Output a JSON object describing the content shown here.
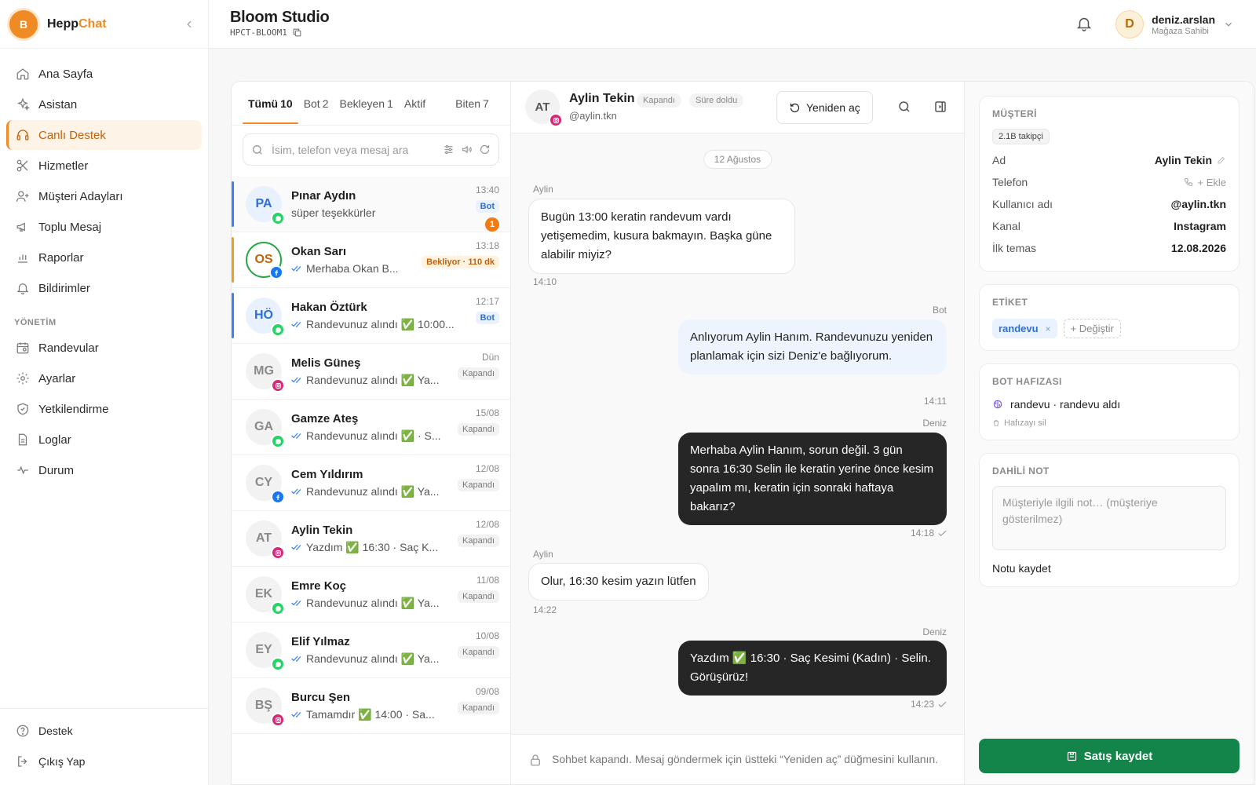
{
  "brand": {
    "initial": "B",
    "name_part1": "Hepp",
    "name_part2": "Chat"
  },
  "nav": {
    "items": [
      {
        "label": "Ana Sayfa"
      },
      {
        "label": "Asistan"
      },
      {
        "label": "Canlı Destek",
        "active": true
      },
      {
        "label": "Hizmetler"
      },
      {
        "label": "Müşteri Adayları"
      },
      {
        "label": "Toplu Mesaj"
      },
      {
        "label": "Raporlar"
      },
      {
        "label": "Bildirimler"
      }
    ],
    "section_label": "YÖNETİM",
    "admin_items": [
      {
        "label": "Randevular"
      },
      {
        "label": "Ayarlar"
      },
      {
        "label": "Yetkilendirme"
      },
      {
        "label": "Loglar"
      },
      {
        "label": "Durum"
      }
    ],
    "bottom_items": [
      {
        "label": "Destek"
      },
      {
        "label": "Çıkış Yap"
      }
    ]
  },
  "header": {
    "workspace_title": "Bloom Studio",
    "workspace_code": "HPCT-BLOOM1",
    "user_initial": "D",
    "user_name": "deniz.arslan",
    "user_role": "Mağaza Sahibi"
  },
  "tabs": [
    {
      "label": "Tümü",
      "count": "10",
      "active": true
    },
    {
      "label": "Bot",
      "count": "2"
    },
    {
      "label": "Bekleyen",
      "count": "1"
    },
    {
      "label": "Aktif",
      "count": ""
    },
    {
      "label": "Biten",
      "count": "7"
    }
  ],
  "search": {
    "placeholder": "İsim, telefon veya mesaj ara"
  },
  "conversations": [
    {
      "initials": "PA",
      "name": "Pınar Aydın",
      "preview": "süper teşekkürler",
      "time": "13:40",
      "tag": "Bot",
      "unread": "1",
      "channel": "whatsapp"
    },
    {
      "initials": "OS",
      "name": "Okan Sarı",
      "preview": "Merhaba Okan B...",
      "time": "13:18",
      "tag": "Bekliyor · 110 dk",
      "channel": "facebook"
    },
    {
      "initials": "HÖ",
      "name": "Hakan Öztürk",
      "preview": "Randevunuz alındı ✅ 10:00...",
      "time": "12:17",
      "tag": "Bot",
      "channel": "whatsapp"
    },
    {
      "initials": "MG",
      "name": "Melis Güneş",
      "preview": "Randevunuz alındı ✅ Ya...",
      "time": "Dün",
      "tag": "Kapandı",
      "channel": "instagram"
    },
    {
      "initials": "GA",
      "name": "Gamze Ateş",
      "preview": "Randevunuz alındı ✅ · S...",
      "time": "15/08",
      "tag": "Kapandı",
      "channel": "whatsapp"
    },
    {
      "initials": "CY",
      "name": "Cem Yıldırım",
      "preview": "Randevunuz alındı ✅ Ya...",
      "time": "12/08",
      "tag": "Kapandı",
      "channel": "facebook"
    },
    {
      "initials": "AT",
      "name": "Aylin Tekin",
      "preview": "Yazdım ✅ 16:30 · Saç K...",
      "time": "12/08",
      "tag": "Kapandı",
      "channel": "instagram"
    },
    {
      "initials": "EK",
      "name": "Emre Koç",
      "preview": "Randevunuz alındı ✅ Ya...",
      "time": "11/08",
      "tag": "Kapandı",
      "channel": "whatsapp"
    },
    {
      "initials": "EY",
      "name": "Elif Yılmaz",
      "preview": "Randevunuz alındı ✅ Ya...",
      "time": "10/08",
      "tag": "Kapandı",
      "channel": "whatsapp"
    },
    {
      "initials": "BŞ",
      "name": "Burcu Şen",
      "preview": "Tamamdır ✅ 14:00 · Sa...",
      "time": "09/08",
      "tag": "Kapandı",
      "channel": "instagram"
    }
  ],
  "chat": {
    "initials": "AT",
    "name": "Aylin Tekin",
    "handle": "@aylin.tkn",
    "status_closed": "Kapandı",
    "status_expired": "Süre doldu",
    "reopen_label": "Yeniden aç",
    "date": "12 Ağustos",
    "messages": [
      {
        "sender": "Aylin",
        "text": "Bugün 13:00 keratin randevum vardı yetişemedim, kusura bakmayın. Başka güne alabilir miyiz?",
        "time": "14:10"
      },
      {
        "sender": "Bot",
        "text": "Anlıyorum Aylin Hanım. Randevunuzu yeniden planlamak için sizi Deniz'e bağlıyorum.",
        "time": "14:11"
      },
      {
        "sender": "Deniz",
        "text": "Merhaba Aylin Hanım, sorun değil. 3 gün sonra 16:30 Selin ile keratin yerine önce kesim yapalım mı, keratin için sonraki haftaya bakarız?",
        "time": "14:18"
      },
      {
        "sender": "Aylin",
        "text": "Olur, 16:30 kesim yazın lütfen",
        "time": "14:22"
      },
      {
        "sender": "Deniz",
        "text": "Yazdım ✅ 16:30 · Saç Kesimi (Kadın) · Selin. Görüşürüz!",
        "time": "14:23"
      }
    ],
    "closed_notice": "Sohbet kapandı. Mesaj göndermek için üstteki “Yeniden aç” düğmesini kullanın."
  },
  "customer": {
    "title": "MÜŞTERİ",
    "followers": "2.1B takipçi",
    "fields": [
      {
        "key": "Ad",
        "value": "Aylin Tekin"
      },
      {
        "key": "Telefon",
        "value": "+ Ekle"
      },
      {
        "key": "Kullanıcı adı",
        "value": "@aylin.tkn"
      },
      {
        "key": "Kanal",
        "value": "Instagram"
      },
      {
        "key": "İlk temas",
        "value": "12.08.2026"
      }
    ]
  },
  "tags_card": {
    "title": "ETİKET",
    "tag": "randevu",
    "change_label": "+ Değiştir"
  },
  "memory": {
    "title": "BOT HAFIZASI",
    "text": "randevu · randevu aldı",
    "delete_label": "Hafızayı sil"
  },
  "note": {
    "title": "DAHİLİ NOT",
    "placeholder": "Müşteriyle ilgili not… (müşteriye gösterilmez)",
    "save_label": "Notu kaydet"
  },
  "sale_button": "Satış kaydet",
  "colors": {
    "accent": "#f08a24",
    "whatsapp": "#25d366",
    "facebook": "#1877f2",
    "instagram": "#d62976",
    "sale": "#13854a"
  }
}
